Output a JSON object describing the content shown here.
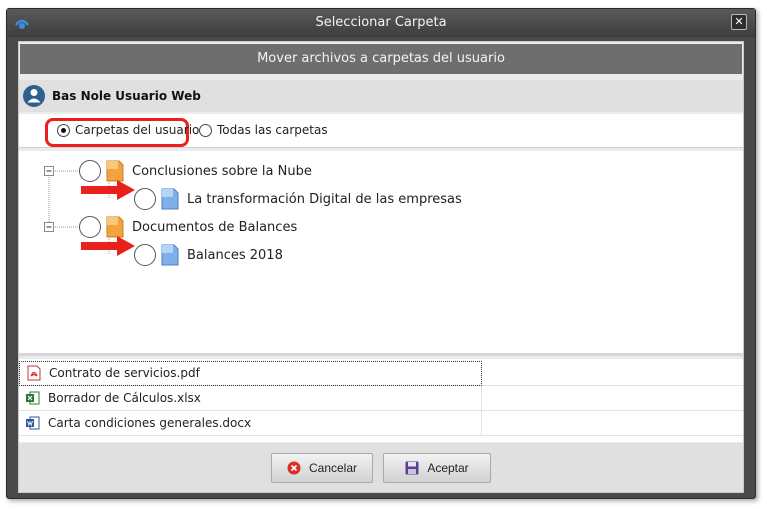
{
  "window": {
    "title": "Seleccionar Carpeta",
    "close_glyph": "✕"
  },
  "header": {
    "text": "Mover archivos a carpetas del usuario"
  },
  "user": {
    "name": "Bas Nole Usuario Web",
    "icon": "user-icon"
  },
  "scope": {
    "options": [
      {
        "label": "Carpetas del usuario",
        "checked": true
      },
      {
        "label": "Todas las carpetas",
        "checked": false
      }
    ]
  },
  "tree": {
    "nodes": [
      {
        "label": "Conclusiones sobre la Nube",
        "level": 0,
        "color": "orange"
      },
      {
        "label": "La transformación Digital de las empresas",
        "level": 1,
        "color": "blue"
      },
      {
        "label": "Documentos de Balances",
        "level": 0,
        "color": "orange"
      },
      {
        "label": "Balances 2018",
        "level": 1,
        "color": "blue"
      }
    ]
  },
  "files": [
    {
      "name": "Contrato de servicios.pdf",
      "type": "pdf-icon"
    },
    {
      "name": "Borrador de Cálculos.xlsx",
      "type": "excel-icon"
    },
    {
      "name": "Carta condiciones generales.docx",
      "type": "word-icon"
    }
  ],
  "buttons": {
    "cancel": "Cancelar",
    "accept": "Aceptar"
  },
  "colors": {
    "highlight": "#e8211c",
    "accent_red": "#e8211c"
  }
}
